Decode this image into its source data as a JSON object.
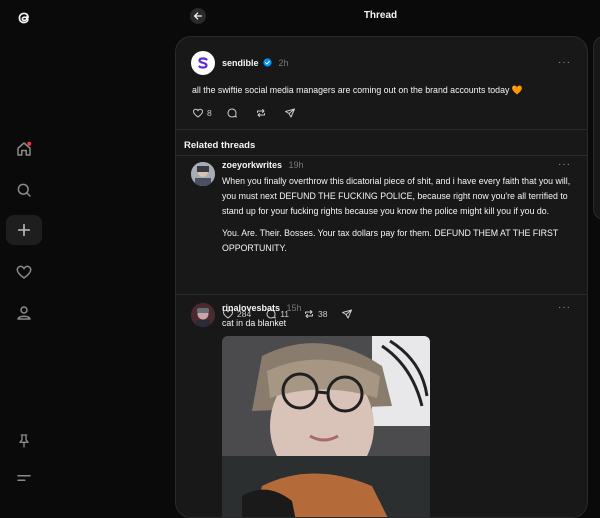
{
  "window": {
    "title": "Thread"
  },
  "sidebar": {
    "items": [
      "threads-logo-icon",
      "home-icon",
      "search-icon",
      "new-thread-icon",
      "heart-icon",
      "profile-icon",
      "pin-icon",
      "menu-icon"
    ]
  },
  "main_post": {
    "username": "sendible",
    "time": "2h",
    "text": "all the swiftie social media managers are coming out on the brand accounts today 🧡",
    "likes": "8"
  },
  "related": {
    "heading": "Related threads"
  },
  "posts": [
    {
      "username": "zoeyorkwrites",
      "time": "19h",
      "paragraphs": [
        "When you finally overthrow this dicatorial piece of shit, and i have every faith that you will, you must next DEFUND THE FUCKING POLICE, because right now you're all terrified to stand up for your fucking rights because you know the police might kill you if you do.",
        "You. Are. Their. Bosses. Your tax dollars pay for them. DEFUND THEM AT THE FIRST OPPORTUNITY."
      ],
      "likes": "284",
      "replies": "11",
      "reposts": "38"
    },
    {
      "username": "rinalovesbats",
      "time": "15h",
      "text": "cat in da blanket"
    }
  ],
  "colors": {
    "accent_verified": "#0095f6",
    "notification_dot": "#ff3040",
    "card_bg": "#181818",
    "page_bg": "#0a0a0a"
  }
}
